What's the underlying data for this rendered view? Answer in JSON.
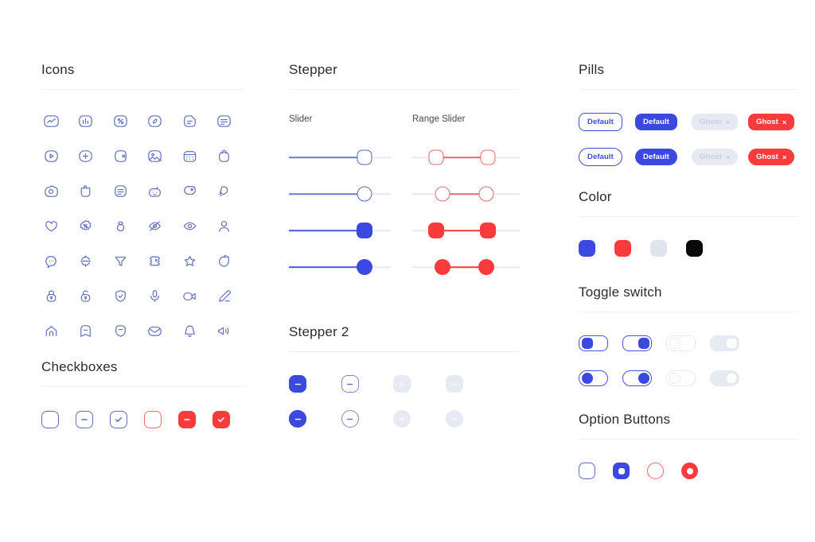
{
  "sections": {
    "icons": {
      "title": "Icons"
    },
    "checkboxes": {
      "title": "Checkboxes"
    },
    "stepper": {
      "title": "Stepper",
      "slider_label": "Slider",
      "range_label": "Range Slider"
    },
    "stepper2": {
      "title": "Stepper 2"
    },
    "pills": {
      "title": "Pills"
    },
    "color": {
      "title": "Color"
    },
    "toggle": {
      "title": "Toggle switch"
    },
    "options": {
      "title": "Option Buttons"
    }
  },
  "icon_rows": [
    [
      "activity-chart-icon",
      "bar-chart-icon",
      "percent-square-icon",
      "compass-leaf-icon",
      "document-icon",
      "document-list-icon"
    ],
    [
      "play-circle-icon",
      "plus-circle-icon",
      "wallet-icon",
      "image-icon",
      "calendar-icon",
      "bag-icon"
    ],
    [
      "camera-icon",
      "trash-icon",
      "note-list-icon",
      "robot-icon",
      "tag-icon",
      "hand-pointer-icon"
    ],
    [
      "heart-icon",
      "badge-percent-icon",
      "ring-icon",
      "eye-off-icon",
      "eye-icon",
      "user-icon"
    ],
    [
      "chat-bubble-icon",
      "sort-arrows-icon",
      "filter-funnel-icon",
      "ticket-icon",
      "star-icon",
      "apple-icon"
    ],
    [
      "lock-closed-icon",
      "lock-open-icon",
      "shield-check-icon",
      "microphone-icon",
      "video-camera-icon",
      "pencil-icon"
    ],
    [
      "home-icon",
      "bookmark-icon",
      "shield-icon",
      "envelope-icon",
      "bell-icon",
      "speaker-icon"
    ]
  ],
  "checkboxes": [
    {
      "name": "checkbox-empty",
      "state": "empty",
      "style": "blue-outline"
    },
    {
      "name": "checkbox-indeterminate",
      "state": "minus",
      "style": "blue-outline"
    },
    {
      "name": "checkbox-checked",
      "state": "check",
      "style": "blue-outline"
    },
    {
      "name": "checkbox-empty-red",
      "state": "empty",
      "style": "red-outline"
    },
    {
      "name": "checkbox-indeterminate-red",
      "state": "minus",
      "style": "red-fill"
    },
    {
      "name": "checkbox-checked-red",
      "state": "check",
      "style": "red-fill"
    }
  ],
  "sliders": {
    "single": [
      {
        "value": 75,
        "handle": "square",
        "fill": "blue"
      },
      {
        "value": 75,
        "handle": "circle",
        "fill": "blue"
      },
      {
        "value": 75,
        "handle": "square-solid",
        "fill": "blue-solid"
      },
      {
        "value": 75,
        "handle": "circle-solid",
        "fill": "blue-solid"
      }
    ],
    "range": [
      {
        "start": 25,
        "end": 75,
        "handle": "square",
        "fill": "red"
      },
      {
        "start": 30,
        "end": 72,
        "handle": "circle",
        "fill": "red"
      },
      {
        "start": 25,
        "end": 75,
        "handle": "square-solid",
        "fill": "red-solid"
      },
      {
        "start": 30,
        "end": 72,
        "handle": "circle-solid",
        "fill": "red-solid"
      }
    ]
  },
  "stepper2": {
    "rows": [
      [
        {
          "name": "stepper-plus-outline",
          "sign": "plus",
          "style": "out"
        },
        {
          "name": "stepper-minus-outline",
          "sign": "minus",
          "style": "out"
        },
        {
          "name": "stepper-plus-filled",
          "sign": "plus",
          "style": "fill"
        },
        {
          "name": "stepper-minus-filled",
          "sign": "minus",
          "style": "fill"
        },
        {
          "name": "stepper-plus-disabled",
          "sign": "plus",
          "style": "dis"
        },
        {
          "name": "stepper-minus-disabled",
          "sign": "minus",
          "style": "dis"
        }
      ],
      [
        {
          "name": "stepper-plus-outline",
          "sign": "plus",
          "style": "out"
        },
        {
          "name": "stepper-minus-outline",
          "sign": "minus",
          "style": "out"
        },
        {
          "name": "stepper-plus-filled",
          "sign": "plus",
          "style": "fill"
        },
        {
          "name": "stepper-minus-filled",
          "sign": "minus",
          "style": "fill"
        },
        {
          "name": "stepper-plus-disabled",
          "sign": "plus",
          "style": "dis"
        },
        {
          "name": "stepper-minus-disabled",
          "sign": "minus",
          "style": "dis"
        }
      ]
    ]
  },
  "pills": {
    "row1": [
      {
        "label": "Default",
        "style": "outline",
        "close": ""
      },
      {
        "label": "Default",
        "style": "solid",
        "close": ""
      },
      {
        "label": "Ghost",
        "style": "ghost",
        "close": "×"
      },
      {
        "label": "Ghost",
        "style": "danger",
        "close": "×"
      }
    ],
    "row2": [
      {
        "label": "Default",
        "style": "outline",
        "close": ""
      },
      {
        "label": "Default",
        "style": "solid",
        "close": ""
      },
      {
        "label": "Ghost",
        "style": "ghost",
        "close": "×"
      },
      {
        "label": "Ghost",
        "style": "danger",
        "close": "×"
      }
    ]
  },
  "colors": [
    {
      "name": "swatch-blue",
      "hex": "#3b49e0"
    },
    {
      "name": "swatch-red",
      "hex": "#f93b3b"
    },
    {
      "name": "swatch-gray",
      "hex": "#e0e4ee"
    },
    {
      "name": "swatch-black",
      "hex": "#0a0a0a"
    }
  ],
  "toggles": {
    "row1": [
      {
        "name": "toggle-square-on-left",
        "state": "on-left"
      },
      {
        "name": "toggle-square-on-right",
        "state": "on-right"
      },
      {
        "name": "toggle-square-off-left",
        "state": "off-left"
      },
      {
        "name": "toggle-square-off-right",
        "state": "off-right"
      }
    ],
    "row2": [
      {
        "name": "toggle-round-on-left",
        "state": "on-left"
      },
      {
        "name": "toggle-round-on-right",
        "state": "on-right"
      },
      {
        "name": "toggle-round-off-left",
        "state": "off-left"
      },
      {
        "name": "toggle-round-off-right",
        "state": "off-right"
      }
    ]
  },
  "options": [
    {
      "name": "option-square-unselected",
      "shape": "sq",
      "style": "b-out",
      "dot": false
    },
    {
      "name": "option-square-selected",
      "shape": "sq",
      "style": "b-fill",
      "dot": true
    },
    {
      "name": "option-circle-unselected",
      "shape": "ci",
      "style": "r-out",
      "dot": false
    },
    {
      "name": "option-circle-selected",
      "shape": "ci",
      "style": "r-fill",
      "dot": true
    }
  ]
}
